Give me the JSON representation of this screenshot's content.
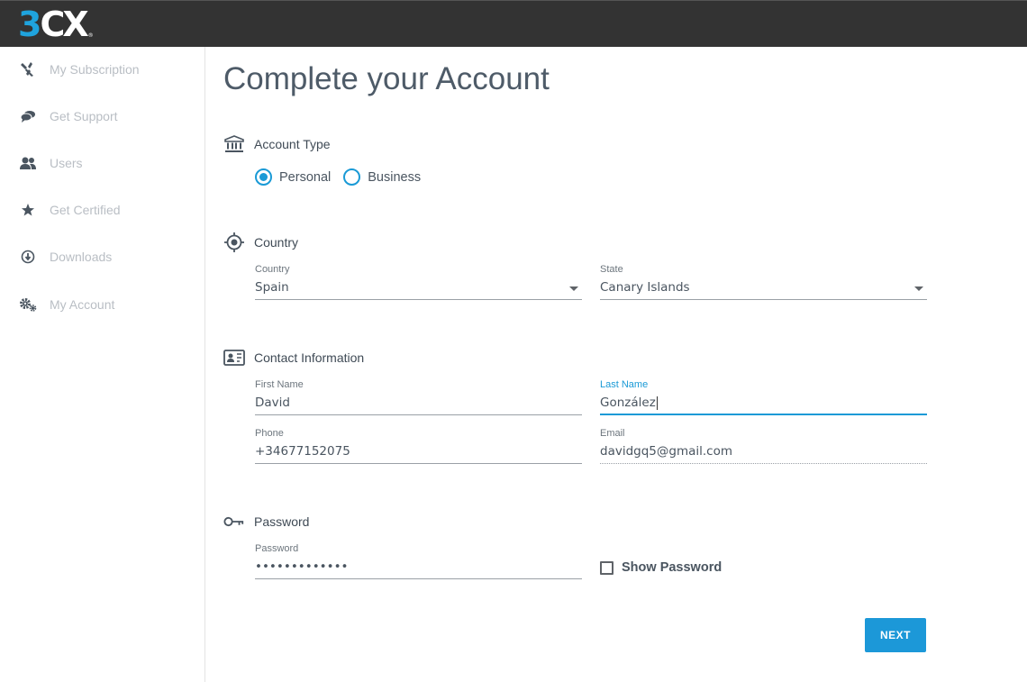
{
  "header": {
    "logo_digit": "3",
    "logo_letters": "CX",
    "logo_mark": "®"
  },
  "sidebar": {
    "items": [
      {
        "label": "My Subscription",
        "icon": "tools-icon"
      },
      {
        "label": "Get Support",
        "icon": "chat-bubbles-icon"
      },
      {
        "label": "Users",
        "icon": "users-icon"
      },
      {
        "label": "Get Certified",
        "icon": "star-icon"
      },
      {
        "label": "Downloads",
        "icon": "download-circle-icon"
      },
      {
        "label": "My Account",
        "icon": "gears-icon"
      }
    ]
  },
  "main": {
    "title": "Complete your Account",
    "account_type": {
      "section_title": "Account Type",
      "options": [
        {
          "label": "Personal",
          "selected": true
        },
        {
          "label": "Business",
          "selected": false
        }
      ]
    },
    "country": {
      "section_title": "Country",
      "country_label": "Country",
      "country_value": "Spain",
      "state_label": "State",
      "state_value": "Canary Islands"
    },
    "contact": {
      "section_title": "Contact Information",
      "first_name_label": "First Name",
      "first_name_value": "David",
      "last_name_label": "Last Name",
      "last_name_value": "González",
      "phone_label": "Phone",
      "phone_value": "+34677152075",
      "email_label": "Email",
      "email_value": "davidgq5@gmail.com"
    },
    "password": {
      "section_title": "Password",
      "password_label": "Password",
      "password_value": "•••••••••••••",
      "show_password_label": "Show Password",
      "show_password_checked": false
    },
    "next_label": "NEXT"
  },
  "colors": {
    "accent": "#1a9ad6",
    "topbar": "#333333",
    "logo_blue": "#1fa3dd"
  }
}
